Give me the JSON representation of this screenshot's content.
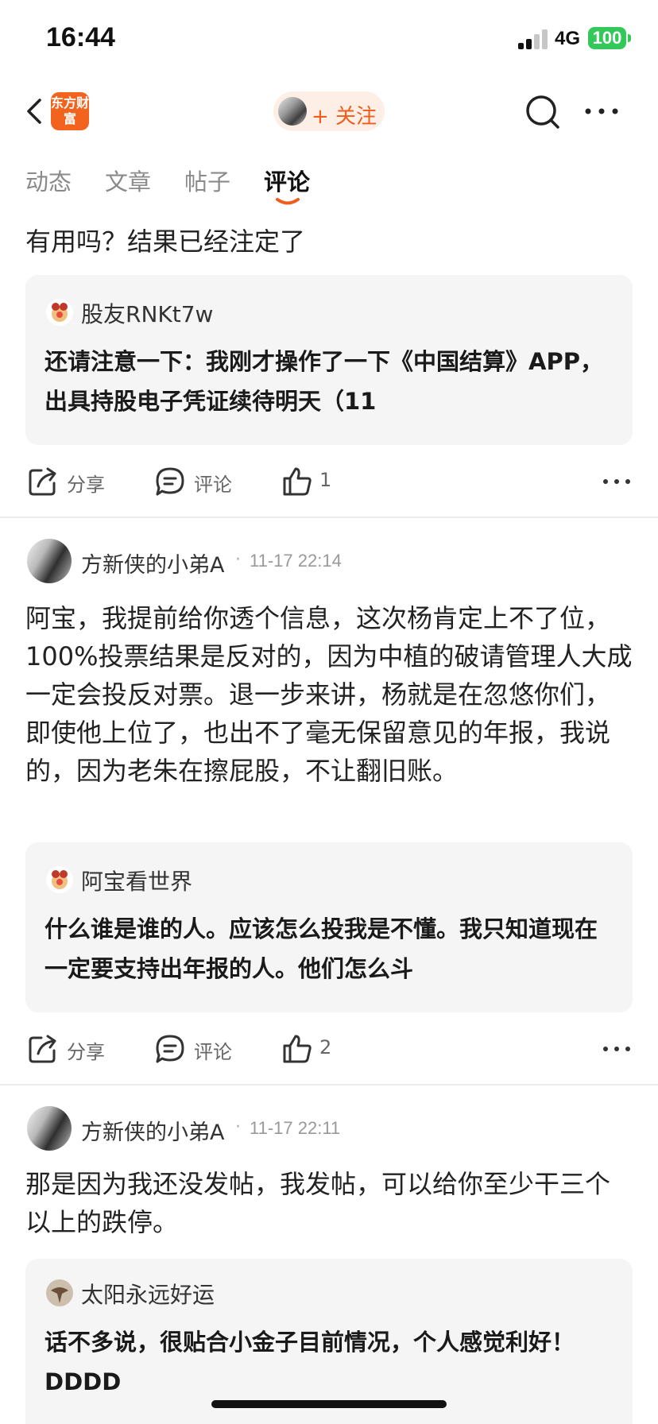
{
  "status_bar": {
    "time": "16:44",
    "network": "4G",
    "battery": "100"
  },
  "nav": {
    "logo_text": "东方财富",
    "follow_label": "+ 关注"
  },
  "tabs": [
    {
      "label": "动态",
      "active": false
    },
    {
      "label": "文章",
      "active": false
    },
    {
      "label": "帖子",
      "active": false
    },
    {
      "label": "评论",
      "active": true
    }
  ],
  "posts": [
    {
      "text": "有用吗？结果已经注定了",
      "quote": {
        "user": "股友RNKt7w",
        "text": "还请注意一下：我刚才操作了一下《中国结算》APP，出具持股电子凭证续待明天（11"
      },
      "actions": {
        "share": "分享",
        "comment": "评论",
        "likes": "1"
      }
    },
    {
      "user": "方新侠的小弟A",
      "time": "11-17 22:14",
      "text": "阿宝，我提前给你透个信息，这次杨肯定上不了位，100%投票结果是反对的，因为中植的破请管理人大成一定会投反对票。退一步来讲，杨就是在忽悠你们，即使他上位了，也出不了毫无保留意见的年报，我说的，因为老朱在擦屁股，不让翻旧账。",
      "quote": {
        "user": "阿宝看世界",
        "text": "什么谁是谁的人。应该怎么投我是不懂。我只知道现在一定要支持出年报的人。他们怎么斗"
      },
      "actions": {
        "share": "分享",
        "comment": "评论",
        "likes": "2"
      }
    },
    {
      "user": "方新侠的小弟A",
      "time": "11-17 22:11",
      "text": "那是因为我还没发帖，我发帖，可以给你至少干三个以上的跌停。",
      "quote": {
        "user": "太阳永远好运",
        "text": "话不多说，很贴合小金子目前情况，个人感觉利好！DDDD"
      }
    }
  ],
  "colors": {
    "accent": "#f25c1b",
    "battery": "#34c759",
    "card_bg": "#f5f5f5"
  },
  "icons": [
    "back-icon",
    "search-icon",
    "more-icon",
    "share-icon",
    "comment-icon",
    "like-icon"
  ]
}
